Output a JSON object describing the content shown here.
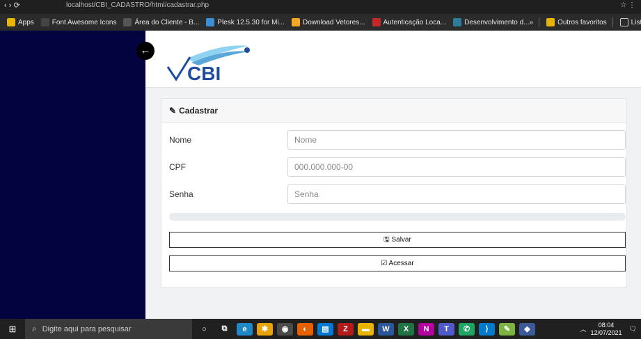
{
  "browser": {
    "url": "localhost/CBI_CADASTRO/html/cadastrar.php",
    "bookmarks": [
      {
        "label": "Apps",
        "icon": "apps-grid-icon",
        "color": "#e8b400"
      },
      {
        "label": "Font Awesome Icons",
        "icon": "flag-icon",
        "color": "#444444"
      },
      {
        "label": "Área do Cliente - B...",
        "icon": "globe-icon",
        "color": "#555555"
      },
      {
        "label": "Plesk 12.5.30 for Mi...",
        "icon": "plesk-icon",
        "color": "#3b8fd6"
      },
      {
        "label": "Download Vetores...",
        "icon": "freepik-icon",
        "color": "#f5a623"
      },
      {
        "label": "Autenticação Loca...",
        "icon": "w-icon",
        "color": "#c62828"
      },
      {
        "label": "Desenvolvimento d...",
        "icon": "dev-icon",
        "color": "#2e7d9a"
      }
    ],
    "more": "»",
    "outros": "Outros favoritos",
    "lista": "Lista de leitura"
  },
  "page": {
    "back_glyph": "←",
    "logo_text": "CBI",
    "card_title": "Cadastrar",
    "fields": [
      {
        "label": "Nome",
        "placeholder": "Nome"
      },
      {
        "label": "CPF",
        "placeholder": "000.000.000-00"
      },
      {
        "label": "Senha",
        "placeholder": "Senha"
      }
    ],
    "progress": 0,
    "save_label": "Salvar",
    "access_label": "Acessar"
  },
  "taskbar": {
    "search_placeholder": "Digite aqui para pesquisar",
    "time": "08:04",
    "date": "12/07/2021"
  },
  "colors": {
    "sidebar": "#030340",
    "logo_blue": "#1f4e9e",
    "logo_light": "#8fd3f0"
  }
}
